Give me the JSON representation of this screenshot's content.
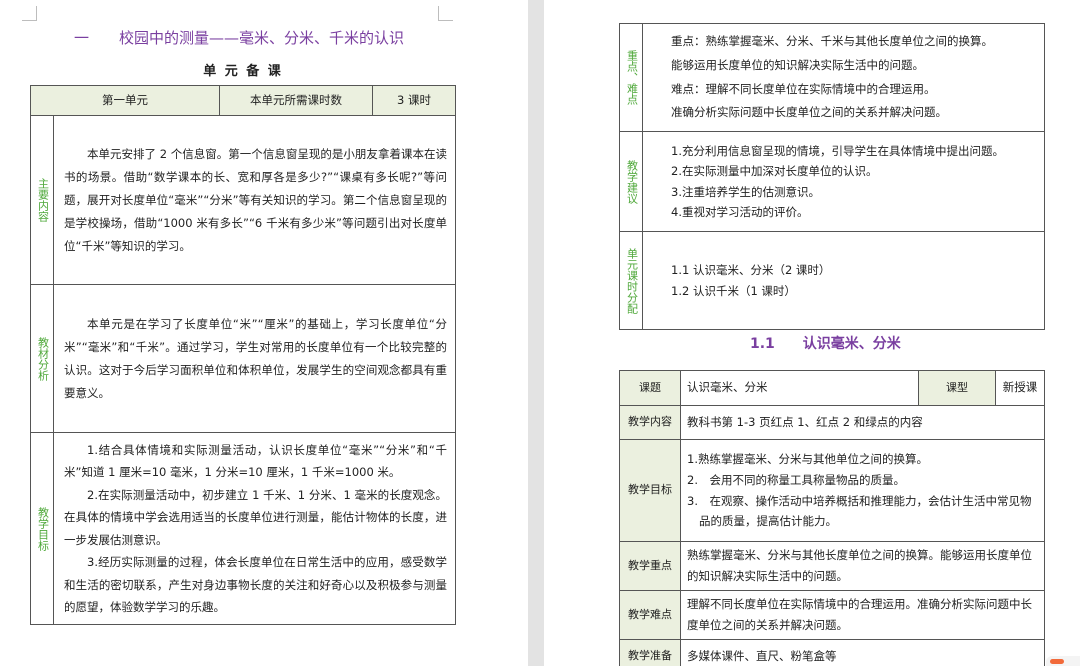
{
  "page1": {
    "chapter_title": "一　　校园中的测量——毫米、分米、千米的认识",
    "section_title": "单 元 备 课",
    "header_row": {
      "unit": "第一单元",
      "hours_label": "本单元所需课时数",
      "hours_value": "3 课时"
    },
    "rows": [
      {
        "label": "主要内容",
        "paragraphs": [
          "本单元安排了 2 个信息窗。第一个信息窗呈现的是小朋友拿着课本在读书的场景。借助“数学课本的长、宽和厚各是多少?”“课桌有多长呢?”等问题，展开对长度单位“毫米”“分米”等有关知识的学习。第二个信息窗呈现的是学校操场，借助“1000 米有多长”“6 千米有多少米”等问题引出对长度单位“千米”等知识的学习。"
        ]
      },
      {
        "label": "教材分析",
        "paragraphs": [
          "本单元是在学习了长度单位“米”“厘米”的基础上，学习长度单位“分米”“毫米”和“千米”。通过学习，学生对常用的长度单位有一个比较完整的认识。这对于今后学习面积单位和体积单位，发展学生的空间观念都具有重要意义。"
        ]
      },
      {
        "label": "教学目标",
        "paragraphs": [
          "1.结合具体情境和实际测量活动，认识长度单位“毫米”“分米”和“千米”知道 1 厘米=10 毫米，1 分米=10 厘米，1 千米=1000 米。",
          "2.在实际测量活动中，初步建立 1 千米、1 分米、1 毫米的长度观念。在具体的情境中学会选用适当的长度单位进行测量，能估计物体的长度，进一步发展估测意识。",
          "3.经历实际测量的过程，体会长度单位在日常生活中的应用，感受数学和生活的密切联系，产生对身边事物长度的关注和好奇心以及积极参与测量的愿望，体验数学学习的乐趣。"
        ]
      }
    ]
  },
  "page2": {
    "top_rows": [
      {
        "label": "重点、难点",
        "lines": [
          "重点：熟练掌握毫米、分米、千米与其他长度单位之间的换算。",
          "能够运用长度单位的知识解决实际生活中的问题。",
          "难点：理解不同长度单位在实际情境中的合理运用。",
          "准确分析实际问题中长度单位之间的关系并解决问题。"
        ]
      },
      {
        "label": "教学建议",
        "lines": [
          "1.充分利用信息窗呈现的情境，引导学生在具体情境中提出问题。",
          "2.在实际测量中加深对长度单位的认识。",
          "3.注重培养学生的估测意识。",
          "4.重视对学习活动的评价。"
        ]
      },
      {
        "label": "单元课时分配",
        "lines": [
          "1.1 认识毫米、分米（2 课时）",
          "1.2 认识千米（1 课时）"
        ]
      }
    ],
    "lesson_title": "1.1　　认识毫米、分米",
    "lesson_table": {
      "topic_label": "课题",
      "topic_value": "认识毫米、分米",
      "type_label": "课型",
      "type_value": "新授课",
      "rows": [
        {
          "label": "教学内容",
          "lines": [
            "教科书第 1-3 页红点 1、红点 2 和绿点的内容"
          ]
        },
        {
          "label": "教学目标",
          "lines": [
            "1.熟练掌握毫米、分米与其他单位之间的换算。",
            "2.　会用不同的称量工具称量物品的质量。",
            "3.　在观察、操作活动中培养概括和推理能力，会估计生活中常见物品的质量，提高估计能力。"
          ]
        },
        {
          "label": "教学重点",
          "lines": [
            "熟练掌握毫米、分米与其他长度单位之间的换算。能够运用长度单位的知识解决实际生活中的问题。"
          ]
        },
        {
          "label": "教学难点",
          "lines": [
            "理解不同长度单位在实际情境中的合理运用。准确分析实际问题中长度单位之间的关系并解决问题。"
          ]
        },
        {
          "label": "教学准备",
          "lines": [
            "多媒体课件、直尺、粉笔盒等"
          ]
        }
      ]
    }
  }
}
